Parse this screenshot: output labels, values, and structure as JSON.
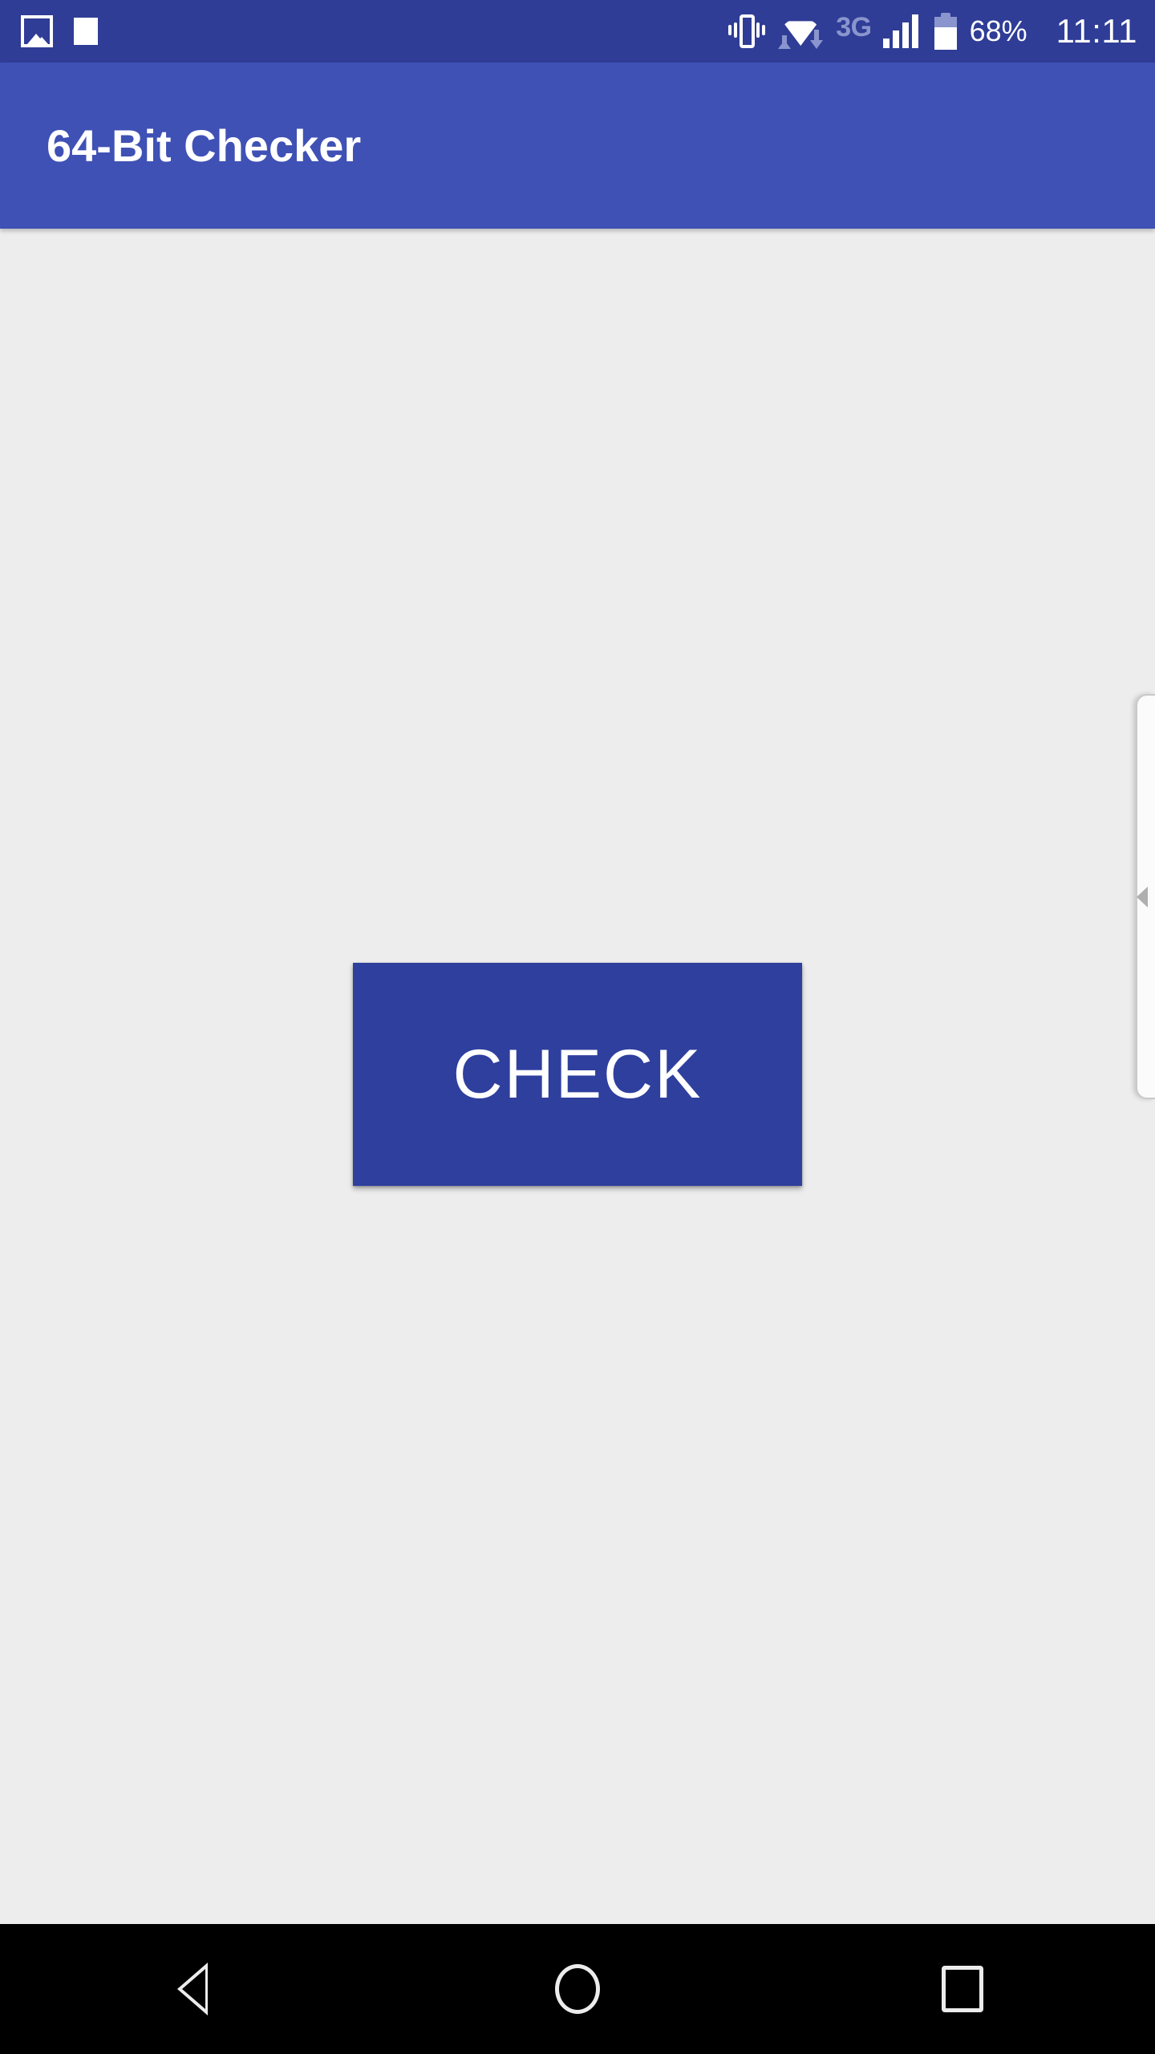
{
  "status_bar": {
    "background_color": "#2F3D96",
    "left_icons": [
      {
        "name": "screenshot-icon",
        "label": "screenshot"
      },
      {
        "name": "square-notification-icon",
        "label": "notification"
      }
    ],
    "right_icons": [
      {
        "name": "vibrate-icon",
        "label": "vibrate"
      },
      {
        "name": "wifi-icon",
        "label": "wifi"
      }
    ],
    "network_type": "3G",
    "signal_bars": 4,
    "battery_percent": "68%",
    "battery_level": 68,
    "clock": "11:11",
    "text_color": "#FFFFFF",
    "muted_color": "#8A95CE"
  },
  "app_bar": {
    "title": "64-Bit Checker",
    "background_color": "#3F51B5",
    "title_color": "#FFFFFF"
  },
  "content": {
    "background_color": "#EDEDED",
    "check_button": {
      "label": "CHECK",
      "background_color": "#2F3F9E",
      "text_color": "#FFFFFF"
    }
  },
  "edge_panel": {
    "handle_icon": "chevron-left-icon",
    "background_color": "#FBFBFB",
    "arrow_color": "#AFAFAF"
  },
  "nav_bar": {
    "background_color": "#000000",
    "buttons": [
      {
        "name": "back-button",
        "icon": "triangle-left-icon"
      },
      {
        "name": "home-button",
        "icon": "circle-icon"
      },
      {
        "name": "recents-button",
        "icon": "square-icon"
      }
    ]
  }
}
